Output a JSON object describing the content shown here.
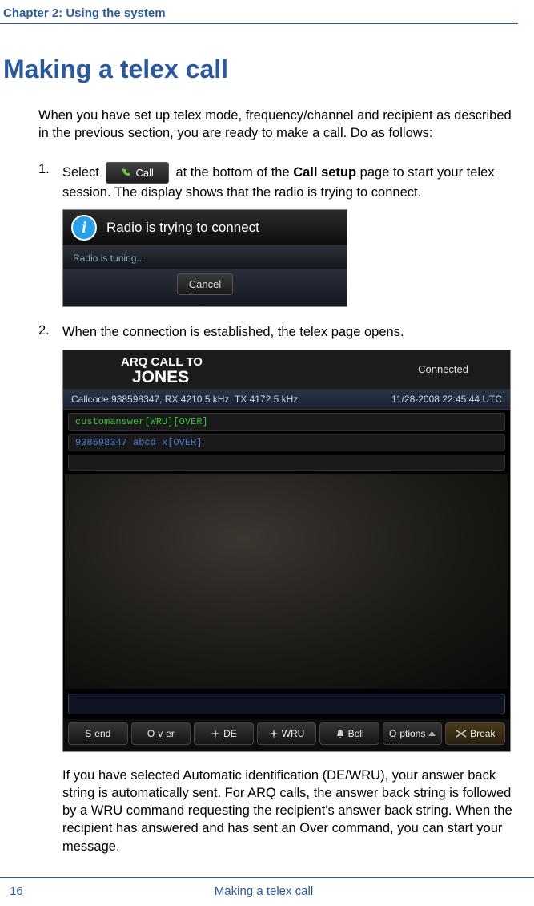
{
  "header": {
    "chapter": "Chapter 2:  Using the system"
  },
  "title": "Making a telex call",
  "intro": "When you have set up telex mode, frequency/channel and recipient as described in the previous section, you are ready to make a call. Do as follows:",
  "step1": {
    "num": "1.",
    "pre": "Select ",
    "button": "Call",
    "post_a": " at the bottom of the ",
    "bold": "Call setup",
    "post_b": " page to start your telex session. The display shows that the radio is trying to connect."
  },
  "dialog1": {
    "title": "Radio is trying to connect",
    "status": "Radio is tuning...",
    "cancel_u": "C",
    "cancel_rest": "ancel"
  },
  "step2": {
    "num": "2.",
    "text": "When the connection is established, the telex page opens."
  },
  "telex": {
    "arq": "ARQ CALL TO",
    "name": "JONES",
    "connected": "Connected",
    "info_left": "Callcode 938598347, RX 4210.5 kHz, TX 4172.5 kHz",
    "info_right": "11/28-2008 22:45:44 UTC",
    "line1": "customanswer[WRU][OVER]",
    "line2": "938598347 abcd x[OVER]",
    "buttons": {
      "send_u": "S",
      "send": "end",
      "over_u": "v",
      "over_pre": "O",
      "over_post": "er",
      "de_u": "D",
      "de": "E",
      "wru_u": "W",
      "wru": "RU",
      "bell_u": "e",
      "bell_pre": "B",
      "bell_post": "ll",
      "options_u": "O",
      "options": "ptions",
      "break_u": "B",
      "break": "reak"
    }
  },
  "after": "If you have selected Automatic identification (DE/WRU), your answer back string is automatically sent. For ARQ calls, the answer back string is followed by a WRU command requesting the recipient's answer back string. When the recipient has answered and has sent an Over command, you can start your message.",
  "footer": {
    "page": "16",
    "title": "Making a telex call"
  }
}
